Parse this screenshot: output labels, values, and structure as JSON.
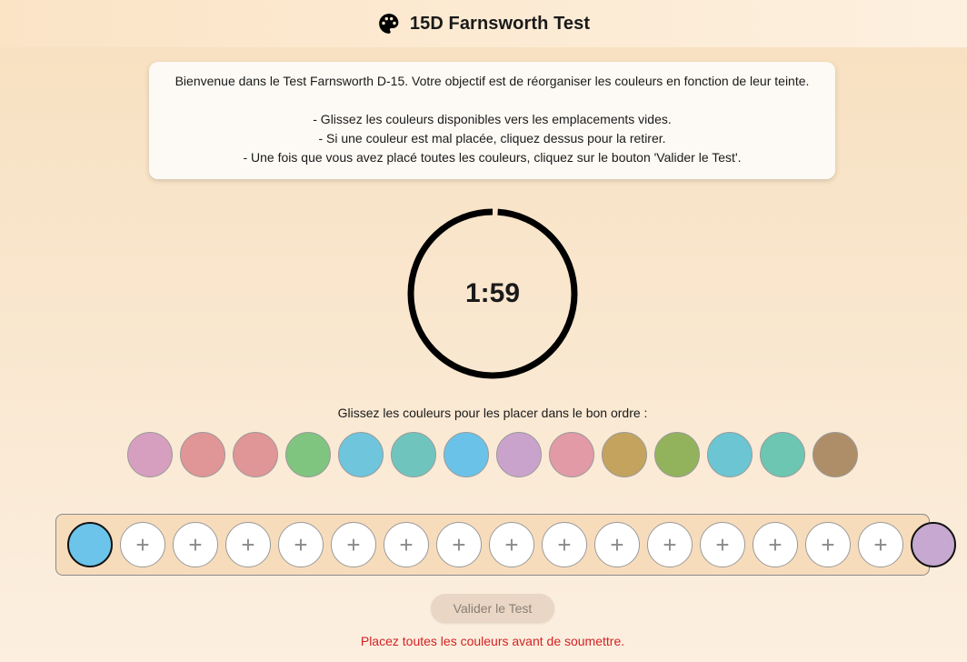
{
  "header": {
    "title": "15D Farnsworth Test",
    "icon": "palette-icon"
  },
  "instructions": {
    "line1": "Bienvenue dans le Test Farnsworth D-15. Votre objectif est de réorganiser les couleurs en fonction de leur teinte.",
    "line2": "- Glissez les couleurs disponibles vers les emplacements vides.",
    "line3": "- Si une couleur est mal placée, cliquez dessus pour la retirer.",
    "line4": "- Une fois que vous avez placé toutes les couleurs, cliquez sur le bouton 'Valider le Test'."
  },
  "timer": {
    "display": "1:59",
    "remaining_fraction": 0.99
  },
  "prompt": "Glissez les couleurs pour les placer dans le bon ordre :",
  "available_colors": [
    "#d69fbf",
    "#e09596",
    "#e09596",
    "#7fc47f",
    "#6ec5dc",
    "#6fc5be",
    "#6bc2e8",
    "#caa3cc",
    "#e19aa6",
    "#c4a35f",
    "#93b25c",
    "#6cc5d2",
    "#6dc6b2",
    "#ad8e68"
  ],
  "tray": {
    "start_color": "#6cc4ea",
    "end_color": "#c6a8d0",
    "empty_slot_count": 15,
    "slot_glyph": "+"
  },
  "submit_label": "Valider le Test",
  "error_message": "Placez toutes les couleurs avant de soumettre."
}
